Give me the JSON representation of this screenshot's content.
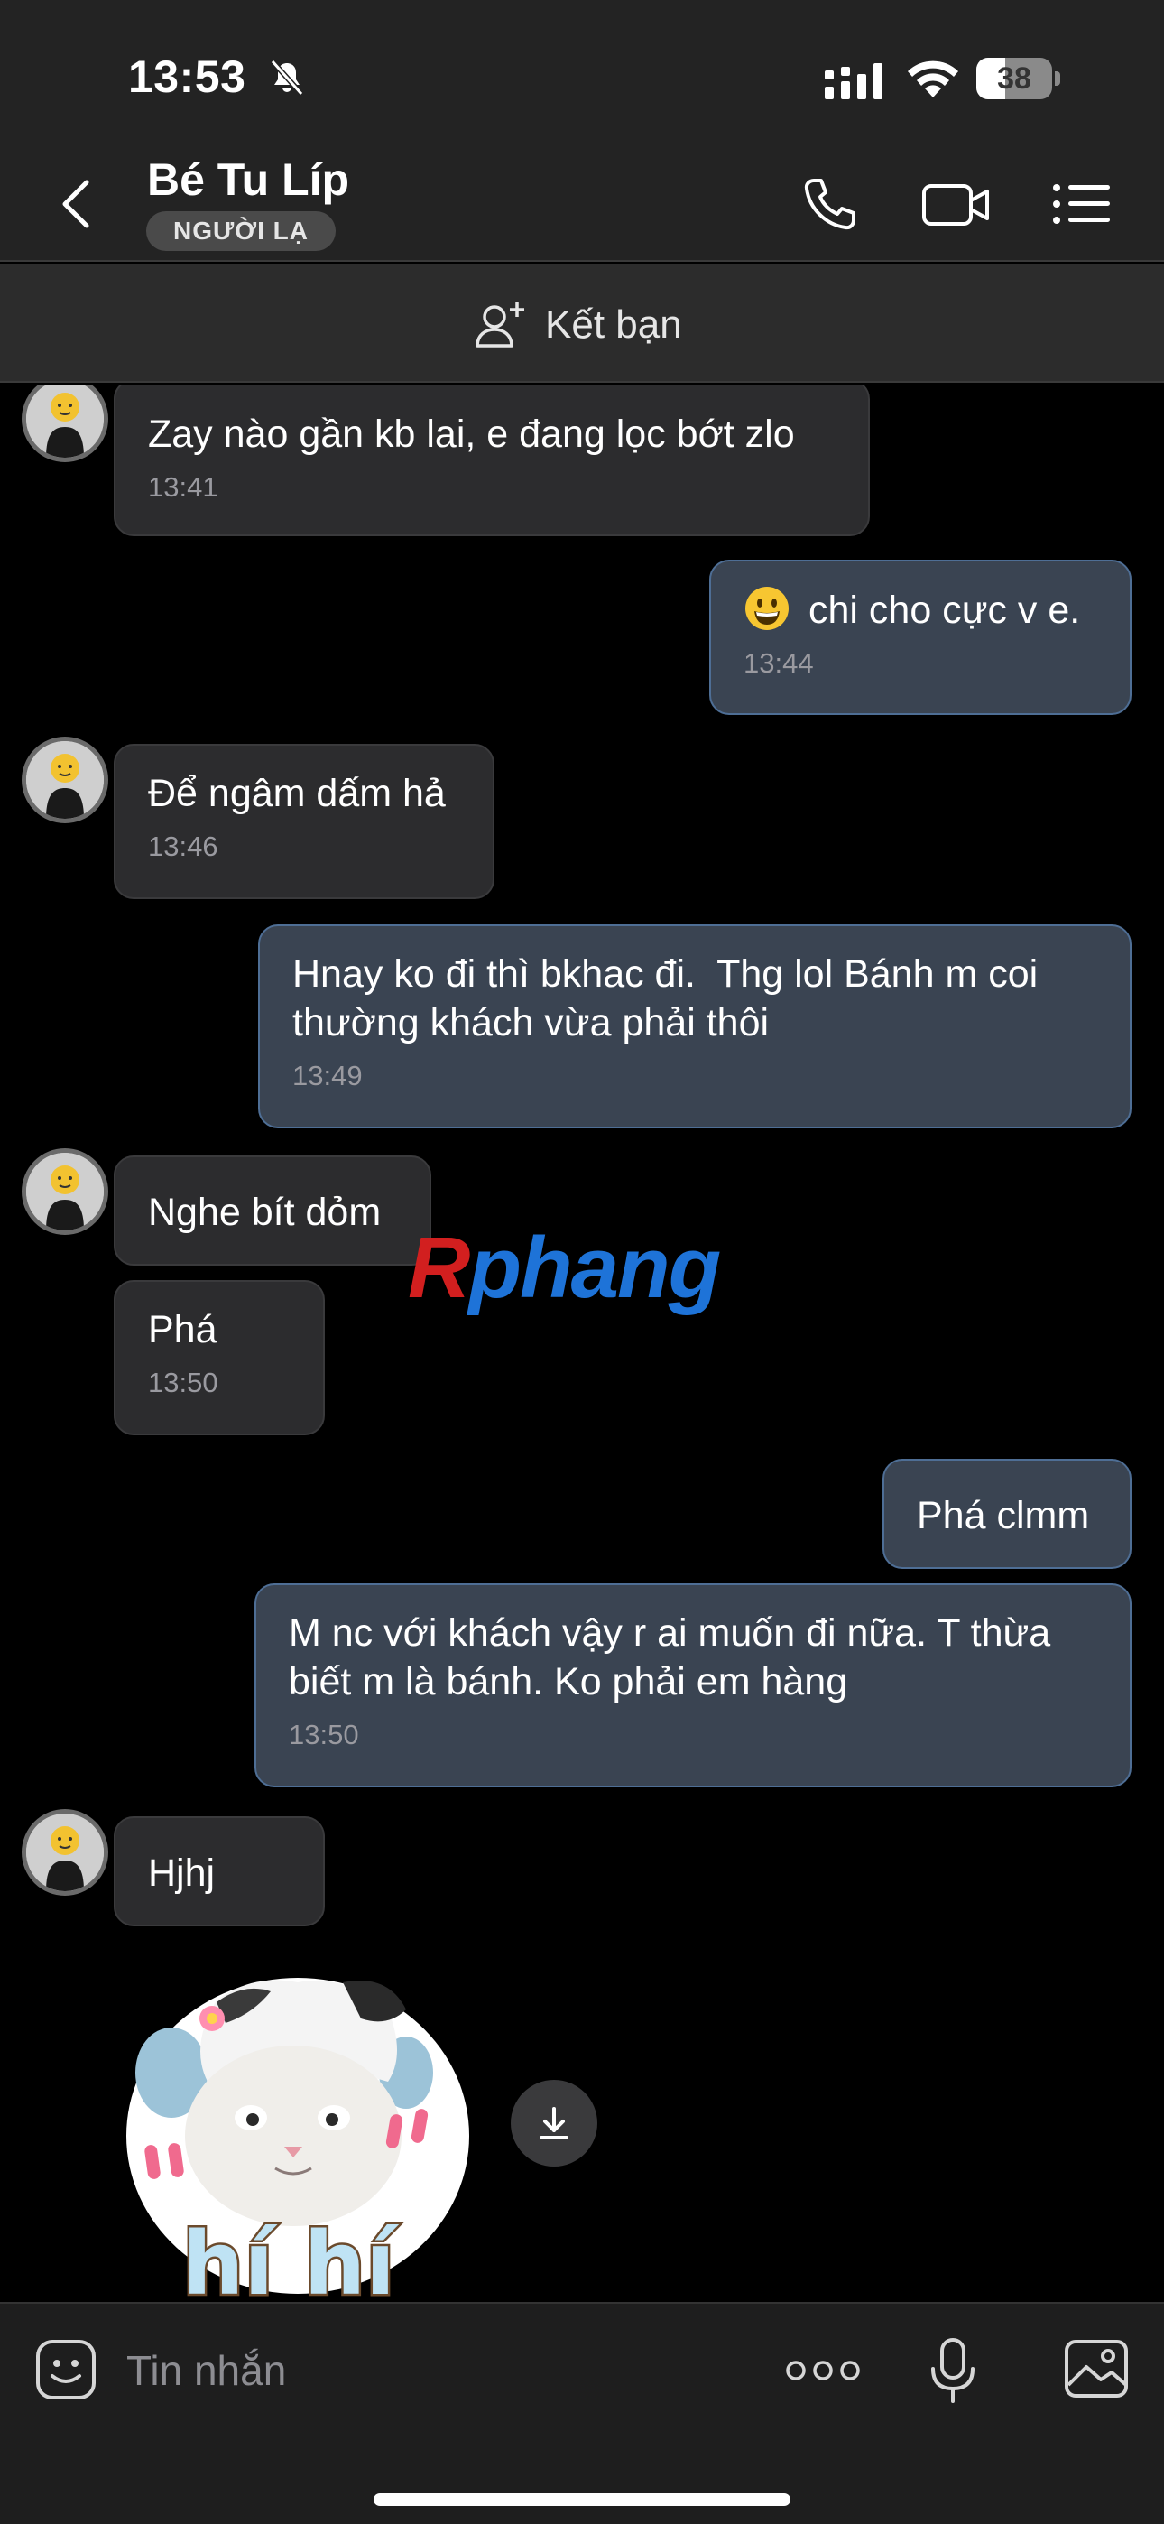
{
  "status_bar": {
    "time": "13:53",
    "battery_level": "38",
    "battery_fraction": 0.38
  },
  "header": {
    "contact_name": "Bé Tu Líp",
    "badge": "NGƯỜI LẠ"
  },
  "friend_bar": {
    "label": "Kết bạn"
  },
  "messages": [
    {
      "dir": "in",
      "text": "Zay nào gần kb lai, e đang lọc bớt zlo",
      "time": "13:41"
    },
    {
      "dir": "out",
      "text": "chi cho cực v e.",
      "emoji": "grinning-face",
      "time": "13:44"
    },
    {
      "dir": "in",
      "text": "Để ngâm dấm hả",
      "time": "13:46"
    },
    {
      "dir": "out",
      "text": "Hnay ko đi thì bkhac đi.  Thg lol Bánh m coi\nthường khách vừa phải thôi",
      "time": "13:49"
    },
    {
      "dir": "in",
      "text": "Nghe bít dỏm"
    },
    {
      "dir": "in",
      "text": "Phá",
      "time": "13:50"
    },
    {
      "dir": "out",
      "text": "Phá clmm"
    },
    {
      "dir": "out",
      "text": "M nc với khách vậy r ai muốn đi nữa. T thừa\nbiết m là bánh. Ko phải em hàng",
      "time": "13:50"
    },
    {
      "dir": "in",
      "text": "Hjhj"
    }
  ],
  "sticker": {
    "caption": "hí hí"
  },
  "watermark": {
    "part1": "R",
    "part2": "phang"
  },
  "composer": {
    "placeholder": "Tin nhắn"
  },
  "colors": {
    "incoming_bubble": "#2c2c2e",
    "outgoing_bubble": "#3a4452",
    "outgoing_border": "#4e6e95",
    "background": "#000000"
  }
}
